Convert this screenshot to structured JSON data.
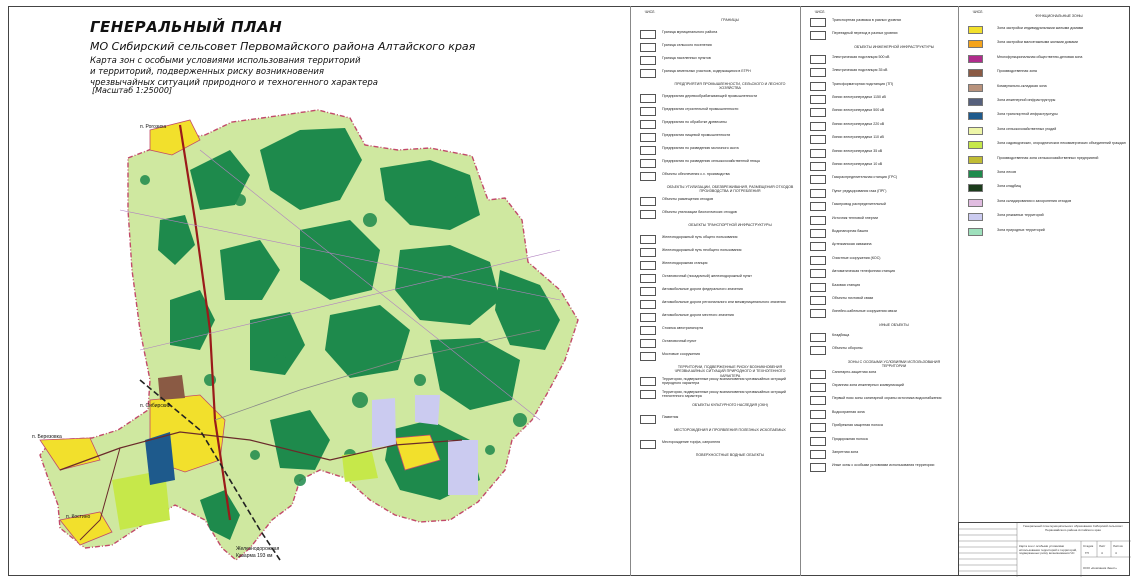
{
  "header": {
    "title": "ГЕНЕРАЛЬНЫЙ ПЛАН",
    "subtitle": "МО Сибирский сельсовет Первомайского района Алтайского края",
    "description_lines": [
      "Карта зон с особыми условиями использования территорий",
      "и территорий, подверженных риску возникновения",
      "чрезвычайных ситуаций природного и техногенного характера"
    ],
    "scale": "[Масштаб 1:25000]"
  },
  "places": {
    "rogozikha": "п. Рогозиха",
    "sibirsky": "п. Сибирский",
    "berezovka": "п. Березовка",
    "kostino": "п. Костино",
    "railway_station": "Железнодорожная",
    "railway_km": "Казарма 193 км"
  },
  "legend1": {
    "col_header": "ЧИСЛ.",
    "group_boundaries": "ГРАНИЦЫ",
    "items_boundaries": [
      "Граница муниципального района",
      "Граница сельского поселения",
      "Граница населенных пунктов",
      "Граница земельных участков, содержащихся в ЕГРН"
    ],
    "group_agro": "ПРЕДПРИЯТИЯ ПРОМЫШЛЕННОСТИ, СЕЛЬСКОГО И ЛЕСНОГО ХОЗЯЙСТВА",
    "items_agro": [
      "Предприятия деревообрабатывающей промышленности",
      "Предприятия строительной промышленности",
      "Предприятия по обработке древесины",
      "Предприятия пищевой промышленности",
      "Предприятия по разведению молочного скота",
      "Предприятия по разведению сельскохозяйственной птицы",
      "Объекты обеспечения с.х. производства"
    ],
    "group_waste": "ОБЪЕКТЫ УТИЛИЗАЦИИ, ОБЕЗВРЕЖИВАНИЯ, РАЗМЕЩЕНИЯ ОТХОДОВ ПРОИЗВОДСТВА И ПОТРЕБЛЕНИЯ",
    "items_waste": [
      "Объекты размещения отходов",
      "Объекты утилизации биологических отходов"
    ],
    "group_transport": "ОБЪЕКТЫ ТРАНСПОРТНОЙ ИНФРАСТРУКТУРЫ",
    "items_transport": [
      "Железнодорожный путь общего пользования",
      "Железнодорожный путь необщего пользования",
      "Железнодорожная станция",
      "Остановочный (посадочный) железнодорожный пункт",
      "Автомобильные дороги федерального значения",
      "Автомобильные дороги регионального или межмуниципального значения",
      "Автомобильные дороги местного значения",
      "Стоянка автотранспорта",
      "Остановочный пункт",
      "Мостовые сооружения"
    ],
    "group_risk": "ТЕРРИТОРИИ, ПОДВЕРЖЕННЫЕ РИСКУ ВОЗНИКНОВЕНИЯ ЧРЕЗВЫЧАЙНЫХ СИТУАЦИЙ ПРИРОДНОГО И ТЕХНОГЕННОГО ХАРАКТЕРА",
    "items_risk": [
      "Территории, подверженные риску возникновения чрезвычайных ситуаций природного характера",
      "Территории, подверженные риску возникновения чрезвычайных ситуаций техногенного характера"
    ],
    "group_heritage": "ОБЪЕКТЫ КУЛЬТУРНОГО НАСЛЕДИЯ (ОКН)",
    "items_heritage": [
      "Памятник"
    ],
    "group_minerals": "МЕСТОРОЖДЕНИЯ И ПРОЯВЛЕНИЯ ПОЛЕЗНЫХ ИСКОПАЕМЫХ",
    "items_minerals": [
      "Месторождение торфа, сапропеля"
    ],
    "group_water": "ПОВЕРХНОСТНЫЕ ВОДНЫЕ ОБЪЕКТЫ"
  },
  "legend2": {
    "col_header": "ЧИСЛ.",
    "items_top": [
      "Транспортная развязка в разных уровнях",
      "Переездный переход в разных уровнях"
    ],
    "group_engineering": "ОБЪЕКТЫ ИНЖЕНЕРНОЙ ИНФРАСТРУКТУРЫ",
    "items_engineering": [
      "Электрическая подстанция 500 кВ",
      "Электрическая подстанция 35 кВ",
      "Трансформаторная подстанция (ТП)",
      "Линии электропередачи 1150 кВ",
      "Линии электропередачи 500 кВ",
      "Линии электропередачи 220 кВ",
      "Линии электропередачи 110 кВ",
      "Линии электропередачи 35 кВ",
      "Линии электропередачи 10 кВ",
      "Газораспределительная станция (ГРС)",
      "Пункт редуцирования газа (ПРГ)",
      "Газопровод распределительный",
      "Источник тепловой энергии",
      "Водонапорная башня",
      "Артезианская скважина",
      "Очистные сооружения (КОС)",
      "Автоматическая телефонная станция",
      "Базовая станция",
      "Объекты почтовой связи",
      "Линейно-кабельные сооружения связи"
    ],
    "group_other": "ИНЫЕ ОБЪЕКТЫ",
    "items_other": [
      "Кладбища",
      "Объекты обороны"
    ],
    "group_zouit": "ЗОНЫ С ОСОБЫМИ УСЛОВИЯМИ ИСПОЛЬЗОВАНИЯ ТЕРРИТОРИИ",
    "items_zouit": [
      "Санитарно-защитная зона",
      "Охранная зона инженерных коммуникаций",
      "Первый пояс зоны санитарной охраны источника водоснабжения",
      "Водоохранная зона",
      "Прибрежная защитная полоса",
      "Придорожная полоса",
      "Запретная зона",
      "Иные зоны с особыми условиями использования территории"
    ]
  },
  "legend3": {
    "col_header": "ЧИСЛ.",
    "group_zones": "ФУНКЦИОНАЛЬНЫЕ ЗОНЫ",
    "zones": [
      {
        "label": "Зона застройки индивидуальными жилыми домами",
        "color": "#f2e02c"
      },
      {
        "label": "Зона застройки малоэтажными жилыми домами",
        "color": "#f5a41c"
      },
      {
        "label": "Многофункциональная общественно-деловая зона",
        "color": "#b02c8c"
      },
      {
        "label": "Производственная зона",
        "color": "#8a5a44"
      },
      {
        "label": "Коммунально-складская зона",
        "color": "#b8927c"
      },
      {
        "label": "Зона инженерной инфраструктуры",
        "color": "#56607c"
      },
      {
        "label": "Зона транспортной инфраструктуры",
        "color": "#1e5a8c"
      },
      {
        "label": "Зона сельскохозяйственных угодий",
        "color": "#eef6a8"
      },
      {
        "label": "Зона садоводческих, огороднических некоммерческих объединений граждан",
        "color": "#c6e84a"
      },
      {
        "label": "Производственная зона сельскохозяйственных предприятий",
        "color": "#c0bc34"
      },
      {
        "label": "Зона лесов",
        "color": "#1e8a4c"
      },
      {
        "label": "Зона кладбищ",
        "color": "#1c3c1c"
      },
      {
        "label": "Зона складирования и захоронения отходов",
        "color": "#e0bce0"
      },
      {
        "label": "Зона режимных территорий",
        "color": "#cbcbf0"
      },
      {
        "label": "Зона природных территорий",
        "color": "#9ee0bc"
      }
    ]
  },
  "stamp": {
    "org": "Генеральный план муниципального образования Сибирский сельсовет Первомайского района Алтайского края",
    "sheet_title": "Карта зон с особыми условиями использования территорий и территорий, подверженных риску возникновения ЧС",
    "labels": [
      "Стадия",
      "Лист",
      "Листов"
    ],
    "values": [
      "ГП",
      "4",
      "4"
    ],
    "company": "ООО «Компания Зенит»"
  },
  "colors": {
    "forest": "#1e8a4c",
    "agri": "#cfe8a0",
    "residential": "#f2e02c",
    "road_federal": "#9a1a1a",
    "boundary": "#c24a6a",
    "railway": "#222222"
  },
  "icons": [
    "legend-symbol-icon"
  ]
}
